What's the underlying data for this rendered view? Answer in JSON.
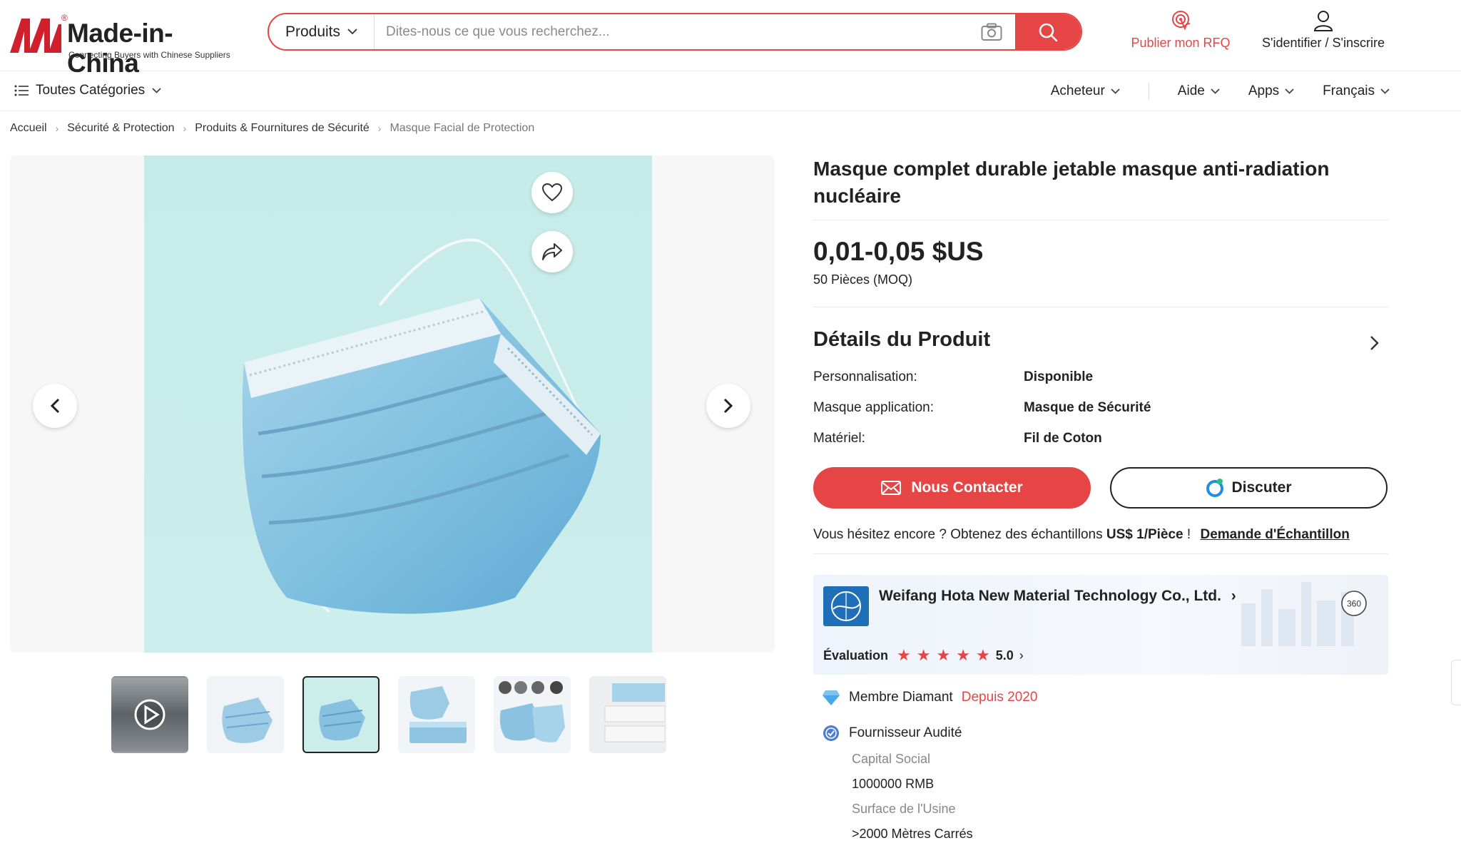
{
  "header": {
    "logo_name": "Made-in-China",
    "logo_tagline": "Connecting Buyers with Chinese Suppliers",
    "search_category": "Produits",
    "search_placeholder": "Dites-nous ce que vous recherchez...",
    "rfq_label": "Publier mon RFQ",
    "login_label": "S'identifier / S'inscrire",
    "accent_color": "#e64545"
  },
  "nav": {
    "categories_label": "Toutes Catégories",
    "items": [
      "Acheteur",
      "Aide",
      "Apps",
      "Français"
    ]
  },
  "breadcrumb": [
    "Accueil",
    "Sécurité & Protection",
    "Produits & Fournitures de Sécurité",
    "Masque Facial de Protection"
  ],
  "product": {
    "title": "Masque complet durable jetable masque anti-radiation nucléaire",
    "price": "0,01-0,05 $US",
    "moq": "50 Pièces (MOQ)",
    "details_heading": "Détails du Produit",
    "attributes": [
      {
        "key": "Personnalisation:",
        "value": "Disponible"
      },
      {
        "key": "Masque application:",
        "value": "Masque de Sécurité"
      },
      {
        "key": "Matériel:",
        "value": "Fil de Coton"
      }
    ],
    "contact_button": "Nous Contacter",
    "chat_button": "Discuter",
    "sample_text": "Vous hésitez encore ? Obtenez des échantillons",
    "sample_price": "US$ 1/Pièce",
    "sample_excl": "!",
    "sample_link": "Demande d'Échantillon"
  },
  "gallery": {
    "thumbnail_count": 6,
    "active_thumbnail": 3,
    "thumb_types": [
      "video",
      "image",
      "image",
      "image",
      "image",
      "image"
    ]
  },
  "supplier": {
    "name": "Weifang Hota New Material Technology Co., Ltd.",
    "rating_label": "Évaluation",
    "rating_value": "5.0",
    "rating_stars": 5,
    "view_360_label": "360",
    "member_label": "Membre Diamant",
    "member_since": "Depuis 2020",
    "audited_label": "Fournisseur Audité",
    "capital_label": "Capital Social",
    "capital_value": "1000000 RMB",
    "factory_label": "Surface de l'Usine",
    "factory_value": ">2000 Mètres Carrés"
  }
}
